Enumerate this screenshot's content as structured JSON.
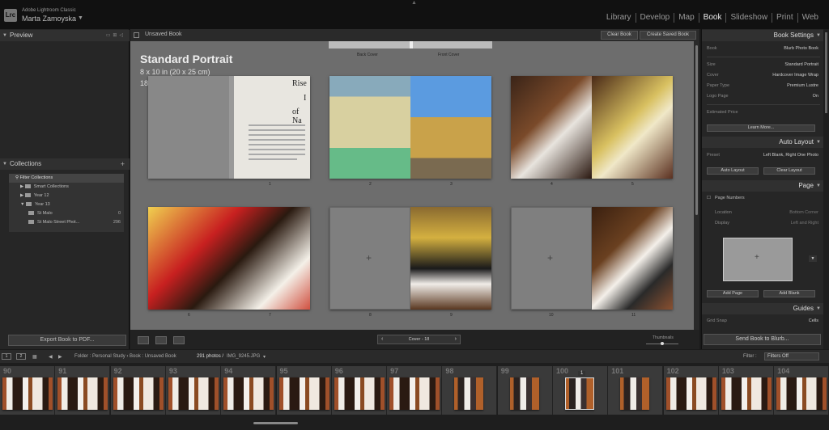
{
  "app": {
    "name": "Adobe Lightroom Classic",
    "logo": "Lrc",
    "user": "Marta Zamoyska",
    "modules": [
      {
        "label": "Library",
        "active": false
      },
      {
        "label": "Develop",
        "active": false
      },
      {
        "label": "Map",
        "active": false
      },
      {
        "label": "Book",
        "active": true
      },
      {
        "label": "Slideshow",
        "active": false
      },
      {
        "label": "Print",
        "active": false
      },
      {
        "label": "Web",
        "active": false
      }
    ]
  },
  "left": {
    "preview_title": "Preview",
    "collections_title": "Collections",
    "filter_label": "Filter Collections",
    "collections": [
      {
        "label": "Smart Collections",
        "count": ""
      },
      {
        "label": "Year 12",
        "count": ""
      },
      {
        "label": "Year 13",
        "count": ""
      },
      {
        "label": "St Malo",
        "count": "0"
      },
      {
        "label": "St Malo Street Phot...",
        "count": "296"
      }
    ],
    "export_label": "Export Book to PDF..."
  },
  "center": {
    "book_title": "Unsaved Book",
    "clear_label": "Clear Book",
    "create_label": "Create Saved Book",
    "back_cover": "Back Cover",
    "front_cover": "Front Cover",
    "layout_name": "Standard Portrait",
    "layout_size": "8 x 10 in (20 x 25 cm)",
    "layout_pages": "18 pages",
    "page_nums": [
      "1",
      "2",
      "3",
      "4",
      "5",
      "6",
      "7",
      "8",
      "9",
      "10",
      "11"
    ],
    "pager": "Cover - 18",
    "thumbnails_label": "Thumbnails",
    "text_page": {
      "line1": "Rise",
      "line2": "I",
      "line3": "of Na"
    }
  },
  "right": {
    "book_settings": "Book Settings",
    "book_label": "Book",
    "book_value": "Blurb Photo Book",
    "size_label": "Size",
    "size_value": "Standard Portrait",
    "cover_label": "Cover",
    "cover_value": "Hardcover Image Wrap",
    "paper_label": "Paper Type",
    "paper_value": "Premium Lustre",
    "logo_label": "Logo Page",
    "logo_value": "On",
    "price_label": "Estimated Price",
    "learn_more": "Learn More...",
    "auto_layout": "Auto Layout",
    "preset_label": "Preset",
    "preset_value": "Left Blank, Right One Photo",
    "auto_layout_btn": "Auto Layout",
    "clear_layout_btn": "Clear Layout",
    "page_title": "Page",
    "page_numbers": "Page Numbers",
    "location_label": "Location",
    "location_value": "Bottom Corner",
    "display_label": "Display",
    "display_value": "Left and Right",
    "add_page": "Add Page",
    "add_blank": "Add Blank",
    "guides": "Guides",
    "grid_snap_label": "Grid Snap",
    "grid_snap_value": "Cells",
    "send_label": "Send Book to Blurb..."
  },
  "filmbar": {
    "monitor1": "1",
    "monitor2": "2",
    "path": "Folder : Personal Study  ›  Book : Unsaved Book",
    "count": "291 photos /",
    "file": "IMG_9245.JPG",
    "filter_label": "Filter :",
    "filter_value": "Filters Off"
  },
  "filmstrip": {
    "cells": [
      {
        "n": "90",
        "t": "sp"
      },
      {
        "n": "91",
        "t": "sp"
      },
      {
        "n": "92",
        "t": "sp"
      },
      {
        "n": "93",
        "t": "sp"
      },
      {
        "n": "94",
        "t": "sp"
      },
      {
        "n": "95",
        "t": "sp"
      },
      {
        "n": "96",
        "t": "sp"
      },
      {
        "n": "97",
        "t": "sp"
      },
      {
        "n": "98",
        "t": "sg"
      },
      {
        "n": "99",
        "t": "sg"
      },
      {
        "n": "100",
        "t": "sg"
      },
      {
        "n": "101",
        "t": "sg"
      },
      {
        "n": "102",
        "t": "sp"
      },
      {
        "n": "103",
        "t": "sp"
      },
      {
        "n": "104",
        "t": "sp"
      }
    ],
    "selected_badge": "1"
  },
  "colors": {
    "accent": "#e8e8e8",
    "panel": "#262626",
    "canvas": "#6d6d6d"
  }
}
